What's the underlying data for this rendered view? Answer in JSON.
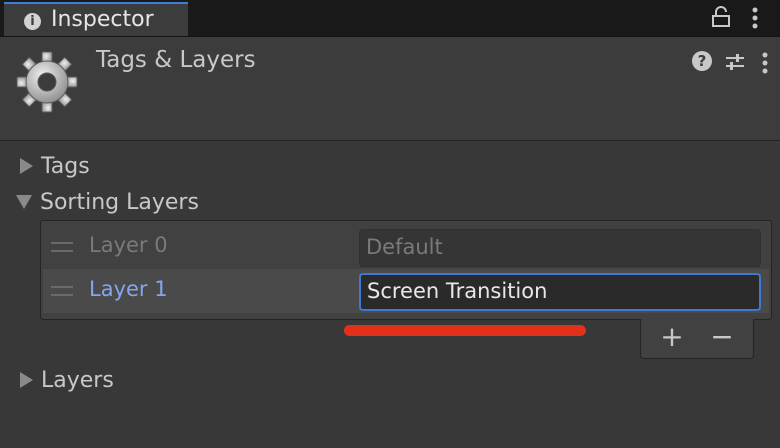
{
  "tab": {
    "title": "Inspector",
    "icon": "info-icon"
  },
  "window_icons": {
    "lock": "lock-icon",
    "menu": "kebab-menu-icon"
  },
  "header": {
    "title": "Tags & Layers",
    "icon": "gear-icon",
    "actions": [
      "help-icon",
      "presets-icon",
      "kebab-menu-icon"
    ]
  },
  "sections": {
    "tags": {
      "label": "Tags",
      "expanded": false
    },
    "sorting_layers": {
      "label": "Sorting Layers",
      "expanded": true
    },
    "layers": {
      "label": "Layers",
      "expanded": false
    }
  },
  "sorting_layers": [
    {
      "label": "Layer 0",
      "value": "Default",
      "editable": false
    },
    {
      "label": "Layer 1",
      "value": "Screen Transition",
      "editable": true,
      "selected": true
    }
  ],
  "list_buttons": {
    "add": "+",
    "remove": "−"
  },
  "colors": {
    "accent": "#3c7ad6",
    "selected_label": "#84a6ef",
    "annotation": "#e2301a"
  }
}
